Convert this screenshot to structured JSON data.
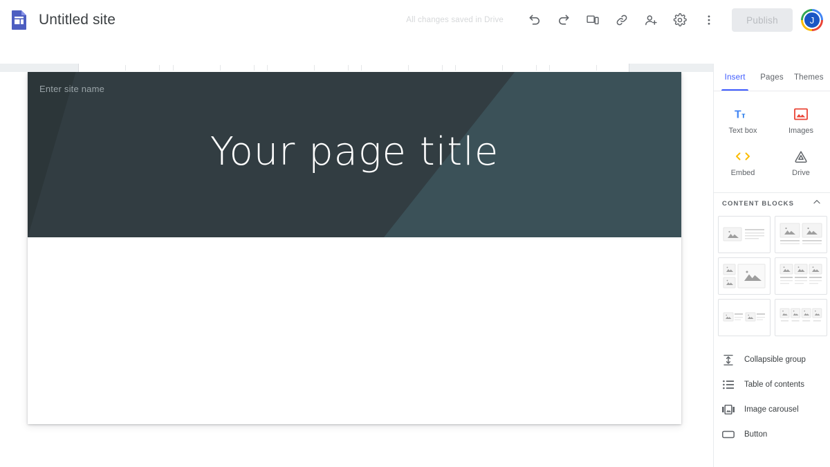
{
  "header": {
    "logo_icon": "google-sites-logo",
    "doc_title": "Untitled site",
    "save_status": "All changes saved in Drive",
    "tools": [
      {
        "name": "undo",
        "icon": "undo-icon"
      },
      {
        "name": "redo",
        "icon": "redo-icon"
      },
      {
        "name": "preview",
        "icon": "preview-device-icon"
      },
      {
        "name": "copy-link",
        "icon": "link-icon"
      },
      {
        "name": "share",
        "icon": "person-add-icon"
      },
      {
        "name": "settings",
        "icon": "gear-icon"
      },
      {
        "name": "more",
        "icon": "more-vert-icon"
      }
    ],
    "publish_label": "Publish",
    "avatar_initial": "J"
  },
  "canvas": {
    "site_name_placeholder": "Enter site name",
    "page_title": "Your page title",
    "banner_color": "#323d42",
    "banner_accent_color": "#3b5158"
  },
  "sidebar": {
    "tabs": [
      {
        "label": "Insert",
        "active": true
      },
      {
        "label": "Pages",
        "active": false
      },
      {
        "label": "Themes",
        "active": false
      }
    ],
    "insert_items": [
      {
        "label": "Text box",
        "icon": "text-box-icon",
        "color": "#4285f4"
      },
      {
        "label": "Images",
        "icon": "image-icon",
        "color": "#ea4335"
      },
      {
        "label": "Embed",
        "icon": "embed-code-icon",
        "color": "#fbbc05"
      },
      {
        "label": "Drive",
        "icon": "google-drive-icon",
        "color": "#5f6368"
      }
    ],
    "content_blocks": {
      "title": "CONTENT BLOCKS",
      "collapse_icon": "chevron-up-icon",
      "layouts": [
        {
          "name": "image-left-text-right"
        },
        {
          "name": "two-images-with-captions"
        },
        {
          "name": "two-small-images-one-large"
        },
        {
          "name": "three-images-with-text"
        },
        {
          "name": "two-image-text-pairs"
        },
        {
          "name": "four-images-with-captions"
        }
      ]
    },
    "list_items": [
      {
        "label": "Collapsible group",
        "icon": "collapsible-group-icon"
      },
      {
        "label": "Table of contents",
        "icon": "table-of-contents-icon"
      },
      {
        "label": "Image carousel",
        "icon": "image-carousel-icon"
      },
      {
        "label": "Button",
        "icon": "button-icon"
      }
    ]
  }
}
